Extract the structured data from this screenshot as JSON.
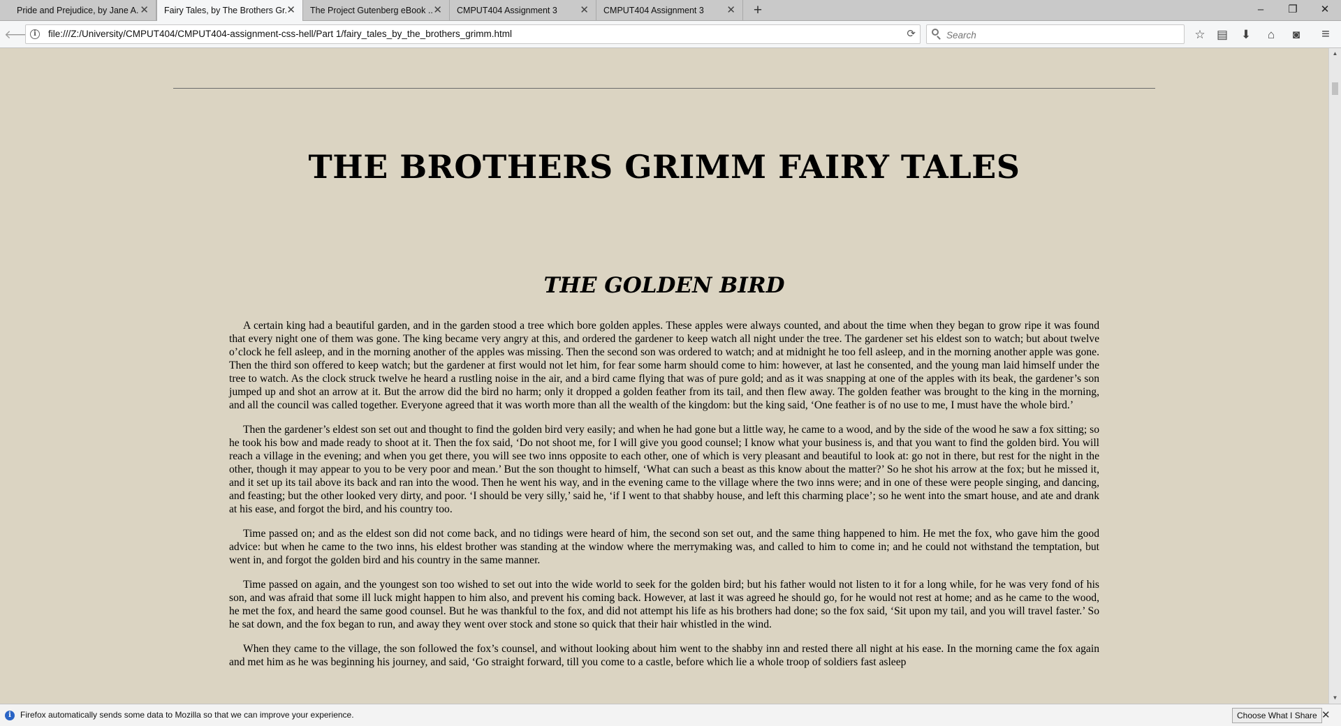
{
  "browser": {
    "tabs": [
      {
        "label": "Pride and Prejudice, by Jane A...",
        "active": false
      },
      {
        "label": "Fairy Tales, by The Brothers Gr...",
        "active": true
      },
      {
        "label": "The Project Gutenberg eBook ...",
        "active": false
      },
      {
        "label": "CMPUT404 Assignment 3",
        "active": false
      },
      {
        "label": "CMPUT404 Assignment 3",
        "active": false
      }
    ],
    "new_tab": "+",
    "window_controls": {
      "minimize": "–",
      "restore": "❐",
      "close": "✕"
    },
    "url": "file:///Z:/University/CMPUT404/CMPUT404-assignment-css-hell/Part 1/fairy_tales_by_the_brothers_grimm.html",
    "search_placeholder": "Search",
    "icons": [
      "back-icon",
      "info-icon",
      "reload-icon",
      "search-icon",
      "bookmark-star-icon",
      "reading-list-icon",
      "download-icon",
      "home-icon",
      "pocket-icon",
      "menu-icon"
    ]
  },
  "page": {
    "book_title": "THE BROTHERS GRIMM FAIRY TALES",
    "story_title": "THE GOLDEN BIRD",
    "paragraphs": [
      "A certain king had a beautiful garden, and in the garden stood a tree which bore golden apples. These apples were always counted, and about the time when they began to grow ripe it was found that every night one of them was gone. The king became very angry at this, and ordered the gardener to keep watch all night under the tree. The gardener set his eldest son to watch; but about twelve o’clock he fell asleep, and in the morning another of the apples was missing. Then the second son was ordered to watch; and at midnight he too fell asleep, and in the morning another apple was gone. Then the third son offered to keep watch; but the gardener at first would not let him, for fear some harm should come to him: however, at last he consented, and the young man laid himself under the tree to watch. As the clock struck twelve he heard a rustling noise in the air, and a bird came flying that was of pure gold; and as it was snapping at one of the apples with its beak, the gardener’s son jumped up and shot an arrow at it. But the arrow did the bird no harm; only it dropped a golden feather from its tail, and then flew away. The golden feather was brought to the king in the morning, and all the council was called together. Everyone agreed that it was worth more than all the wealth of the kingdom: but the king said, ‘One feather is of no use to me, I must have the whole bird.’",
      "Then the gardener’s eldest son set out and thought to find the golden bird very easily; and when he had gone but a little way, he came to a wood, and by the side of the wood he saw a fox sitting; so he took his bow and made ready to shoot at it. Then the fox said, ‘Do not shoot me, for I will give you good counsel; I know what your business is, and that you want to find the golden bird. You will reach a village in the evening; and when you get there, you will see two inns opposite to each other, one of which is very pleasant and beautiful to look at: go not in there, but rest for the night in the other, though it may appear to you to be very poor and mean.’ But the son thought to himself, ‘What can such a beast as this know about the matter?’ So he shot his arrow at the fox; but he missed it, and it set up its tail above its back and ran into the wood. Then he went his way, and in the evening came to the village where the two inns were; and in one of these were people singing, and dancing, and feasting; but the other looked very dirty, and poor. ‘I should be very silly,’ said he, ‘if I went to that shabby house, and left this charming place’; so he went into the smart house, and ate and drank at his ease, and forgot the bird, and his country too.",
      "Time passed on; and as the eldest son did not come back, and no tidings were heard of him, the second son set out, and the same thing happened to him. He met the fox, who gave him the good advice: but when he came to the two inns, his eldest brother was standing at the window where the merrymaking was, and called to him to come in; and he could not withstand the temptation, but went in, and forgot the golden bird and his country in the same manner.",
      "Time passed on again, and the youngest son too wished to set out into the wide world to seek for the golden bird; but his father would not listen to it for a long while, for he was very fond of his son, and was afraid that some ill luck might happen to him also, and prevent his coming back. However, at last it was agreed he should go, for he would not rest at home; and as he came to the wood, he met the fox, and heard the same good counsel. But he was thankful to the fox, and did not attempt his life as his brothers had done; so the fox said, ‘Sit upon my tail, and you will travel faster.’ So he sat down, and the fox began to run, and away they went over stock and stone so quick that their hair whistled in the wind.",
      "When they came to the village, the son followed the fox’s counsel, and without looking about him went to the shabby inn and rested there all night at his ease. In the morning came the fox again and met him as he was beginning his journey, and said, ‘Go straight forward, till you come to a castle, before which lie a whole troop of soldiers fast asleep"
    ]
  },
  "notification": {
    "message": "Firefox automatically sends some data to Mozilla so that we can improve your experience.",
    "button": "Choose What I Share",
    "close": "✕"
  },
  "colors": {
    "page_background": "#dbd4c2",
    "toolbar": "#f5f6f7",
    "tabstrip": "#c9c9c9"
  }
}
